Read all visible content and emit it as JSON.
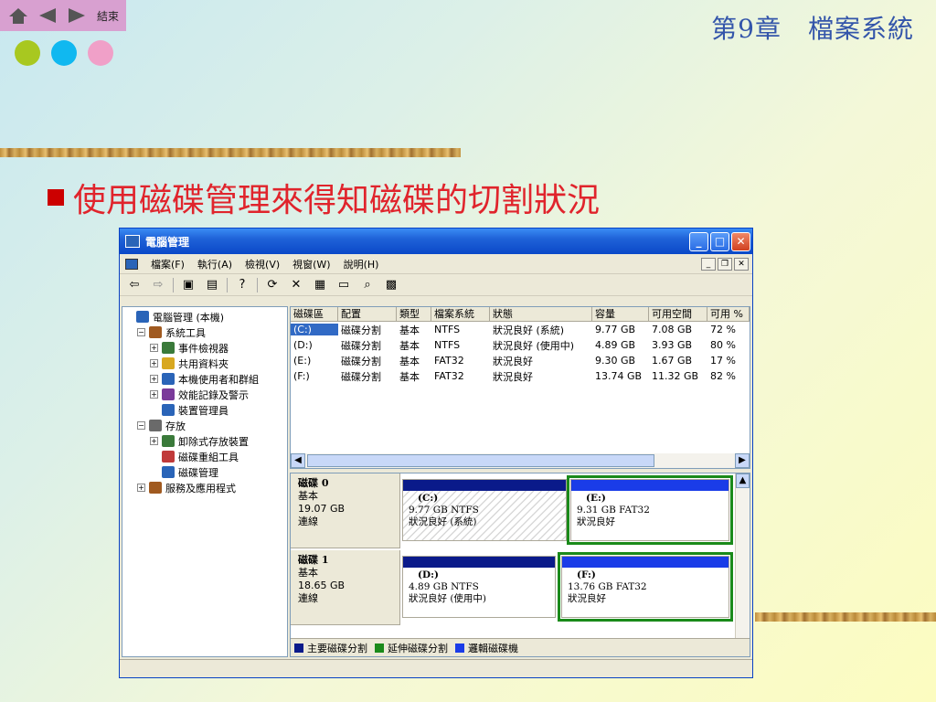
{
  "slide": {
    "nav_end_label": "結束",
    "chapter_title": "第9章　檔案系統",
    "bullet_text": "使用磁碟管理來得知磁碟的切割狀況",
    "dot_colors": [
      "#a8c820",
      "#10b8f0",
      "#f0a0c8"
    ],
    "accent_color": "#e0242c"
  },
  "window": {
    "title": "電腦管理",
    "menu": [
      "檔案(F)",
      "執行(A)",
      "檢視(V)",
      "視窗(W)",
      "說明(H)"
    ],
    "toolbar_icons": [
      "back-icon",
      "forward-icon",
      "up-icon",
      "show-hide-tree-icon",
      "properties-icon",
      "help-icon",
      "refresh-icon",
      "delete-icon",
      "properties2-icon",
      "open-icon",
      "find-icon",
      "settings-icon"
    ]
  },
  "tree": [
    {
      "label": "電腦管理 (本機)",
      "depth": 0,
      "expander": ""
    },
    {
      "label": "系統工具",
      "depth": 1,
      "expander": "−"
    },
    {
      "label": "事件檢視器",
      "depth": 2,
      "expander": "+"
    },
    {
      "label": "共用資料夾",
      "depth": 2,
      "expander": "+"
    },
    {
      "label": "本機使用者和群組",
      "depth": 2,
      "expander": "+"
    },
    {
      "label": "效能記錄及警示",
      "depth": 2,
      "expander": "+"
    },
    {
      "label": "裝置管理員",
      "depth": 2,
      "expander": ""
    },
    {
      "label": "存放",
      "depth": 1,
      "expander": "−"
    },
    {
      "label": "卸除式存放裝置",
      "depth": 2,
      "expander": "+"
    },
    {
      "label": "磁碟重組工具",
      "depth": 2,
      "expander": ""
    },
    {
      "label": "磁碟管理",
      "depth": 2,
      "expander": ""
    },
    {
      "label": "服務及應用程式",
      "depth": 1,
      "expander": "+"
    }
  ],
  "volumes": {
    "headers": [
      "磁碟區",
      "配置",
      "類型",
      "檔案系統",
      "狀態",
      "容量",
      "可用空間",
      "可用 %"
    ],
    "rows": [
      [
        "(C:)",
        "磁碟分割",
        "基本",
        "NTFS",
        "狀況良好 (系統)",
        "9.77 GB",
        "7.08 GB",
        "72 %"
      ],
      [
        "(D:)",
        "磁碟分割",
        "基本",
        "NTFS",
        "狀況良好 (使用中)",
        "4.89 GB",
        "3.93 GB",
        "80 %"
      ],
      [
        "(E:)",
        "磁碟分割",
        "基本",
        "FAT32",
        "狀況良好",
        "9.30 GB",
        "1.67 GB",
        "17 %"
      ],
      [
        "(F:)",
        "磁碟分割",
        "基本",
        "FAT32",
        "狀況良好",
        "13.74 GB",
        "11.32 GB",
        "82 %"
      ]
    ]
  },
  "disks": [
    {
      "name": "磁碟 0",
      "type": "基本",
      "size": "19.07 GB",
      "status": "連線",
      "partitions": [
        {
          "label": "(C:)",
          "detail": "9.77 GB NTFS",
          "status": "狀況良好 (系統)",
          "bar_color": "#0a1a8a",
          "hatched": true,
          "selected": false
        },
        {
          "label": "(E:)",
          "detail": "9.31 GB FAT32",
          "status": "狀況良好",
          "bar_color": "#1a3ce8",
          "hatched": false,
          "selected": true
        }
      ]
    },
    {
      "name": "磁碟 1",
      "type": "基本",
      "size": "18.65 GB",
      "status": "連線",
      "partitions": [
        {
          "label": "(D:)",
          "detail": "4.89 GB NTFS",
          "status": "狀況良好 (使用中)",
          "bar_color": "#0a1a8a",
          "hatched": false,
          "selected": false
        },
        {
          "label": "(F:)",
          "detail": "13.76 GB FAT32",
          "status": "狀況良好",
          "bar_color": "#1a3ce8",
          "hatched": false,
          "selected": true
        }
      ]
    }
  ],
  "legend": [
    {
      "label": "主要磁碟分割",
      "color": "#0a1a8a"
    },
    {
      "label": "延伸磁碟分割",
      "color": "#1a8a1a"
    },
    {
      "label": "邏輯磁碟機",
      "color": "#1a3ce8"
    }
  ]
}
